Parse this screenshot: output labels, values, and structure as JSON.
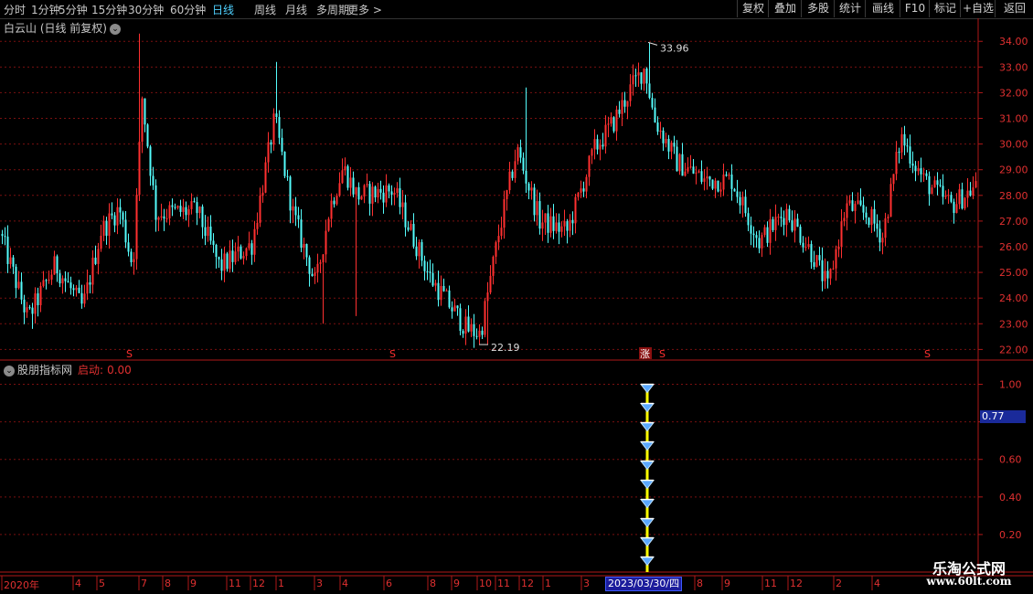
{
  "toolbar": {
    "tabs": [
      {
        "label": "分时",
        "active": false
      },
      {
        "label": "1分钟",
        "active": false
      },
      {
        "label": "5分钟",
        "active": false
      },
      {
        "label": "15分钟",
        "active": false
      },
      {
        "label": "30分钟",
        "active": false
      },
      {
        "label": "60分钟",
        "active": false
      },
      {
        "label": "日线",
        "active": true
      },
      {
        "label": "周线",
        "active": false
      },
      {
        "label": "月线",
        "active": false
      },
      {
        "label": "多周期",
        "active": false
      },
      {
        "label": "更多 >",
        "active": false
      }
    ],
    "right_buttons": [
      "复权",
      "叠加",
      "多股",
      "统计",
      "画线",
      "F10",
      "标记",
      "+自选",
      "返回"
    ]
  },
  "main_chart": {
    "title": "白云山 (日线 前复权)",
    "y_ticks": [
      "34.00",
      "33.00",
      "32.00",
      "31.00",
      "30.00",
      "29.00",
      "28.00",
      "27.00",
      "26.00",
      "25.00",
      "24.00",
      "23.00",
      "22.00"
    ],
    "high_label": "33.96",
    "low_label": "22.19",
    "s_markers": [
      "S",
      "S",
      "S",
      "S"
    ],
    "zhang_marker": "涨"
  },
  "indicator": {
    "name": "股朋指标网",
    "label": "启动:",
    "value": "0.00",
    "y_ticks": [
      "1.00",
      "0.60",
      "0.40",
      "0.20"
    ],
    "crosshair_value": "0.77"
  },
  "x_axis": {
    "ticks": [
      "2020年",
      "4",
      "5",
      "7",
      "8",
      "9",
      "11",
      "12",
      "1",
      "3",
      "4",
      "6",
      "8",
      "9",
      "10",
      "11",
      "12",
      "1",
      "3",
      "8",
      "9",
      "11",
      "12",
      "2",
      "4"
    ],
    "selected_date": "2023/03/30/四"
  },
  "watermark": {
    "title": "乐淘公式网",
    "url": "www.60lt.com"
  },
  "chart_data": {
    "type": "candlestick",
    "title": "白云山 (日线 前复权)",
    "ylim": [
      21.8,
      34.4
    ],
    "max_price": 33.96,
    "min_price": 22.19,
    "indicator_ylim": [
      0,
      1.1
    ],
    "indicator_signal": {
      "date": "2023/03/30",
      "value": 1.0
    }
  },
  "colors": {
    "up": "#ff3030",
    "down": "#54fcfc",
    "grid": "#7a1010",
    "accent": "#4fd1ff"
  }
}
